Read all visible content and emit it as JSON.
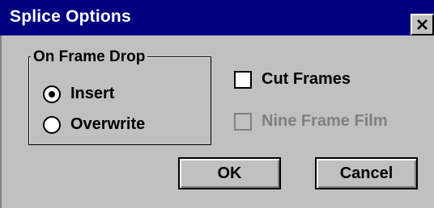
{
  "window": {
    "title": "Splice Options",
    "close_icon": "close-x-icon"
  },
  "group": {
    "label": "On Frame Drop",
    "options": [
      {
        "label": "Insert",
        "selected": true
      },
      {
        "label": "Overwrite",
        "selected": false
      }
    ]
  },
  "checkboxes": [
    {
      "label": "Cut Frames",
      "checked": false,
      "enabled": true
    },
    {
      "label": "Nine Frame Film",
      "checked": false,
      "enabled": false
    }
  ],
  "buttons": {
    "ok": "OK",
    "cancel": "Cancel"
  },
  "colors": {
    "titlebar": "#000080",
    "face": "#c0c0c0",
    "disabled_text": "#808080"
  }
}
